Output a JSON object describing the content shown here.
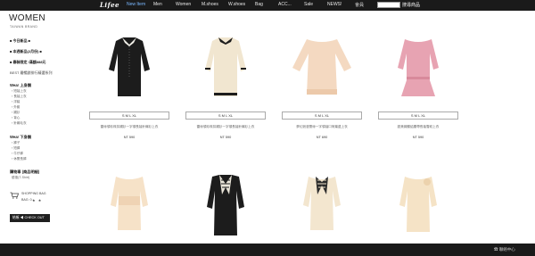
{
  "nav": {
    "logo": "Lifee",
    "items": [
      "New Item",
      "Men",
      "Women",
      "M.shoes",
      "W.shoes",
      "Bag",
      "ACC...",
      "Sale",
      "NEWS!"
    ],
    "member": "會員",
    "search_button": "搜尋商品"
  },
  "sidebar": {
    "title": "WOMEN",
    "subtitle": "TAIWAN BRAND",
    "links": [
      "■ 今日新品 ■",
      "■ 本週新品(2月份) ■",
      "■ 春裝限定 /滿額888元"
    ],
    "special": "BEST 最暢銷排行精選系列",
    "top_head": "Wear 上身類",
    "top_items": [
      "› 短袖上衣",
      "› 長袖上衣",
      "› 洋裝",
      "› 外套",
      "› 襯衫",
      "› 背心",
      "› 針織毛衣"
    ],
    "bottom_head": "Wear 下身類",
    "bottom_items": [
      "› 褲子",
      "› 短褲",
      "› 牛仔褲",
      "› 休閒長褲"
    ],
    "cat_head": "購物車 (商品明細)",
    "cat_item": "優惠(T-Shirt)",
    "bag_label": "SHOPPING BAG",
    "bag_count": "BAG: 0",
    "bag_stars": "★ ★",
    "checkout": "結帳 ◀ CHECK OUT"
  },
  "products": [
    {
      "size": "S  M  L  XL",
      "name": "雷絲領珍珠扣襯衫一字領長袖針織衫上衣",
      "price": "NT 590",
      "icon": "black-blouse-icon"
    },
    {
      "size": "S  M  L  XL",
      "name": "雷絲領珍珠扣襯衫一字領長袖針織衫上衣",
      "price": "NT 590",
      "icon": "cream-blouse-icon"
    },
    {
      "size": "S  M  L  XL",
      "name": "夢幻浪漫蕾絲一字領袖口荷葉邊上衣",
      "price": "NT 690",
      "icon": "peach-top-icon"
    },
    {
      "size": "S  M  L  XL",
      "name": "甜美蝴蝶結腰帶長袖雪紡上衣",
      "price": "NT 590",
      "icon": "pink-top-icon"
    },
    {
      "icon": "cream-lace-top-icon"
    },
    {
      "icon": "black-bow-dress-icon"
    },
    {
      "icon": "cream-bow-top-icon"
    },
    {
      "icon": "cream-ruffle-top-icon"
    }
  ],
  "footer": {
    "contact": "☎ 聯絡中心"
  }
}
